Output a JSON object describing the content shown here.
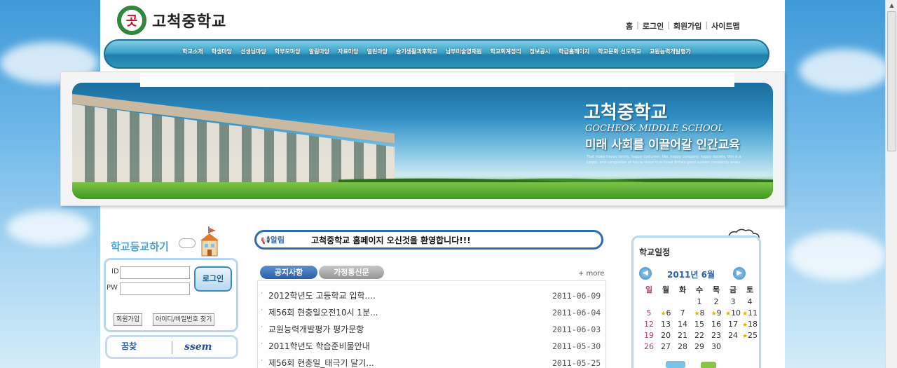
{
  "header": {
    "school_name": "고척중학교",
    "top_links": [
      "홈",
      "로그인",
      "회원가입",
      "사이트맵"
    ]
  },
  "nav": {
    "items": [
      "학교소개",
      "학생마당",
      "선생님마당",
      "학부모마당",
      "알림마당",
      "자료마당",
      "열린마당",
      "슬기생활과후학교",
      "남부미술영재원",
      "학교회계정리",
      "정보공시",
      "학급홈페이지",
      "학교문화 선도학교",
      "교원능력개발평가"
    ]
  },
  "banner": {
    "title": "고척중학교",
    "subtitle_en": "GOCHEOK MIDDLE SCHOOL",
    "slogan": "미래 사회를 이끌어갈 인간교육",
    "small_text": "That make happy family, happy costumer, like, happy company, happy society, this is a target, and completion of future vision that Great Britain good system constantly seeks."
  },
  "login": {
    "title": "학교등교하기",
    "id_label": "ID",
    "pw_label": "PW",
    "id_value": "",
    "pw_value": "",
    "login_button": "로그인",
    "signup_button": "회원가입",
    "find_button": "아이디/비밀번호 찾기"
  },
  "partners": {
    "left": "꿈찾",
    "right": "ssem"
  },
  "alert": {
    "tag": "알림",
    "message": "고척중학교 홈페이지 오신것을 환영합니다!!!"
  },
  "board": {
    "tabs": [
      "공지사항",
      "가정통신문"
    ],
    "more": "+ more",
    "bullet": "·",
    "notices": [
      {
        "title": "2012학년도 고등학교 입학....",
        "date": "2011-06-09"
      },
      {
        "title": "제56회 현충일오전10시 1분...",
        "date": "2011-06-04"
      },
      {
        "title": "교원능력개발평가 평가문항",
        "date": "2011-06-03"
      },
      {
        "title": "2011학년도 학습준비물안내",
        "date": "2011-05-30"
      },
      {
        "title": "제56회 현충일_태극기 달기...",
        "date": "2011-05-25"
      }
    ]
  },
  "calendar": {
    "title": "학교일정",
    "month_label": "2011년 6월",
    "prev": "◀",
    "next": "▶",
    "weekdays": [
      "일",
      "월",
      "화",
      "수",
      "목",
      "금",
      "토"
    ],
    "weeks": [
      [
        "",
        "",
        "",
        "1",
        "2",
        "3",
        "4"
      ],
      [
        "5",
        "6",
        "7",
        "8",
        "9",
        "10",
        "11"
      ],
      [
        "12",
        "13",
        "14",
        "15",
        "16",
        "17",
        "18"
      ],
      [
        "19",
        "20",
        "21",
        "22",
        "23",
        "24",
        "25"
      ],
      [
        "26",
        "27",
        "28",
        "29",
        "30",
        "",
        ""
      ]
    ],
    "event_days": [
      "6",
      "8",
      "9",
      "10",
      "11",
      "18",
      "25"
    ]
  },
  "colors": {
    "nav_blue": "#2b95bd",
    "accent_blue": "#2f6ab3",
    "sunday_red": "#c43a66"
  }
}
